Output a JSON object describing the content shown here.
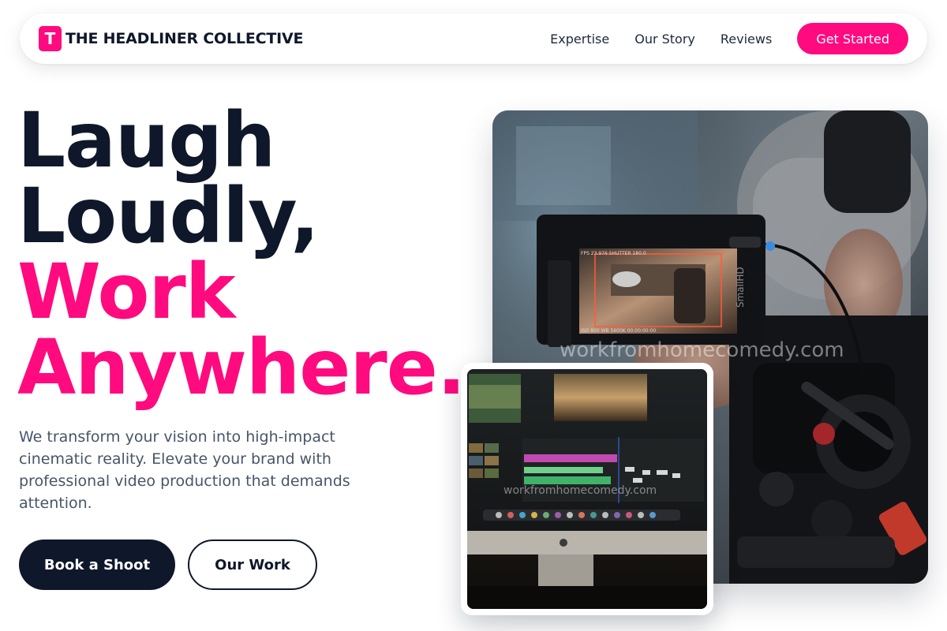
{
  "nav": {
    "brand_mark": "T",
    "brand_name": "THE HEADLINER COLLECTIVE",
    "links": [
      "Expertise",
      "Our Story",
      "Reviews"
    ],
    "cta_label": "Get Started"
  },
  "hero": {
    "headline_line1": "Laugh",
    "headline_line2": "Loudly,",
    "headline_line3": "Work",
    "headline_line4": "Anywhere.",
    "subtitle": "We transform your vision into high-impact cinematic reality. Elevate your brand with professional video production that demands attention.",
    "primary_button": "Book a Shoot",
    "secondary_button": "Our Work"
  },
  "images": {
    "main_watermark": "workfromhomecomedy.com",
    "small_watermark": "workfromhomecomedy.com",
    "monitor_label": "SmallHD"
  },
  "colors": {
    "accent": "#ff0a7f",
    "dark": "#0f172a",
    "muted": "#475569"
  }
}
